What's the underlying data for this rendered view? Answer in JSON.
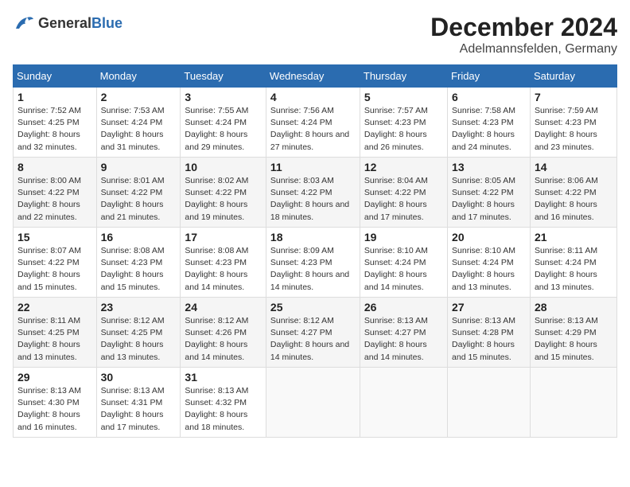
{
  "header": {
    "logo_general": "General",
    "logo_blue": "Blue",
    "month": "December 2024",
    "location": "Adelmannsfelden, Germany"
  },
  "weekdays": [
    "Sunday",
    "Monday",
    "Tuesday",
    "Wednesday",
    "Thursday",
    "Friday",
    "Saturday"
  ],
  "weeks": [
    [
      {
        "day": "1",
        "sunrise": "7:52 AM",
        "sunset": "4:25 PM",
        "daylight": "8 hours and 32 minutes."
      },
      {
        "day": "2",
        "sunrise": "7:53 AM",
        "sunset": "4:24 PM",
        "daylight": "8 hours and 31 minutes."
      },
      {
        "day": "3",
        "sunrise": "7:55 AM",
        "sunset": "4:24 PM",
        "daylight": "8 hours and 29 minutes."
      },
      {
        "day": "4",
        "sunrise": "7:56 AM",
        "sunset": "4:24 PM",
        "daylight": "8 hours and 27 minutes."
      },
      {
        "day": "5",
        "sunrise": "7:57 AM",
        "sunset": "4:23 PM",
        "daylight": "8 hours and 26 minutes."
      },
      {
        "day": "6",
        "sunrise": "7:58 AM",
        "sunset": "4:23 PM",
        "daylight": "8 hours and 24 minutes."
      },
      {
        "day": "7",
        "sunrise": "7:59 AM",
        "sunset": "4:23 PM",
        "daylight": "8 hours and 23 minutes."
      }
    ],
    [
      {
        "day": "8",
        "sunrise": "8:00 AM",
        "sunset": "4:22 PM",
        "daylight": "8 hours and 22 minutes."
      },
      {
        "day": "9",
        "sunrise": "8:01 AM",
        "sunset": "4:22 PM",
        "daylight": "8 hours and 21 minutes."
      },
      {
        "day": "10",
        "sunrise": "8:02 AM",
        "sunset": "4:22 PM",
        "daylight": "8 hours and 19 minutes."
      },
      {
        "day": "11",
        "sunrise": "8:03 AM",
        "sunset": "4:22 PM",
        "daylight": "8 hours and 18 minutes."
      },
      {
        "day": "12",
        "sunrise": "8:04 AM",
        "sunset": "4:22 PM",
        "daylight": "8 hours and 17 minutes."
      },
      {
        "day": "13",
        "sunrise": "8:05 AM",
        "sunset": "4:22 PM",
        "daylight": "8 hours and 17 minutes."
      },
      {
        "day": "14",
        "sunrise": "8:06 AM",
        "sunset": "4:22 PM",
        "daylight": "8 hours and 16 minutes."
      }
    ],
    [
      {
        "day": "15",
        "sunrise": "8:07 AM",
        "sunset": "4:22 PM",
        "daylight": "8 hours and 15 minutes."
      },
      {
        "day": "16",
        "sunrise": "8:08 AM",
        "sunset": "4:23 PM",
        "daylight": "8 hours and 15 minutes."
      },
      {
        "day": "17",
        "sunrise": "8:08 AM",
        "sunset": "4:23 PM",
        "daylight": "8 hours and 14 minutes."
      },
      {
        "day": "18",
        "sunrise": "8:09 AM",
        "sunset": "4:23 PM",
        "daylight": "8 hours and 14 minutes."
      },
      {
        "day": "19",
        "sunrise": "8:10 AM",
        "sunset": "4:24 PM",
        "daylight": "8 hours and 14 minutes."
      },
      {
        "day": "20",
        "sunrise": "8:10 AM",
        "sunset": "4:24 PM",
        "daylight": "8 hours and 13 minutes."
      },
      {
        "day": "21",
        "sunrise": "8:11 AM",
        "sunset": "4:24 PM",
        "daylight": "8 hours and 13 minutes."
      }
    ],
    [
      {
        "day": "22",
        "sunrise": "8:11 AM",
        "sunset": "4:25 PM",
        "daylight": "8 hours and 13 minutes."
      },
      {
        "day": "23",
        "sunrise": "8:12 AM",
        "sunset": "4:25 PM",
        "daylight": "8 hours and 13 minutes."
      },
      {
        "day": "24",
        "sunrise": "8:12 AM",
        "sunset": "4:26 PM",
        "daylight": "8 hours and 14 minutes."
      },
      {
        "day": "25",
        "sunrise": "8:12 AM",
        "sunset": "4:27 PM",
        "daylight": "8 hours and 14 minutes."
      },
      {
        "day": "26",
        "sunrise": "8:13 AM",
        "sunset": "4:27 PM",
        "daylight": "8 hours and 14 minutes."
      },
      {
        "day": "27",
        "sunrise": "8:13 AM",
        "sunset": "4:28 PM",
        "daylight": "8 hours and 15 minutes."
      },
      {
        "day": "28",
        "sunrise": "8:13 AM",
        "sunset": "4:29 PM",
        "daylight": "8 hours and 15 minutes."
      }
    ],
    [
      {
        "day": "29",
        "sunrise": "8:13 AM",
        "sunset": "4:30 PM",
        "daylight": "8 hours and 16 minutes."
      },
      {
        "day": "30",
        "sunrise": "8:13 AM",
        "sunset": "4:31 PM",
        "daylight": "8 hours and 17 minutes."
      },
      {
        "day": "31",
        "sunrise": "8:13 AM",
        "sunset": "4:32 PM",
        "daylight": "8 hours and 18 minutes."
      },
      null,
      null,
      null,
      null
    ]
  ],
  "labels": {
    "sunrise": "Sunrise:",
    "sunset": "Sunset:",
    "daylight": "Daylight:"
  }
}
